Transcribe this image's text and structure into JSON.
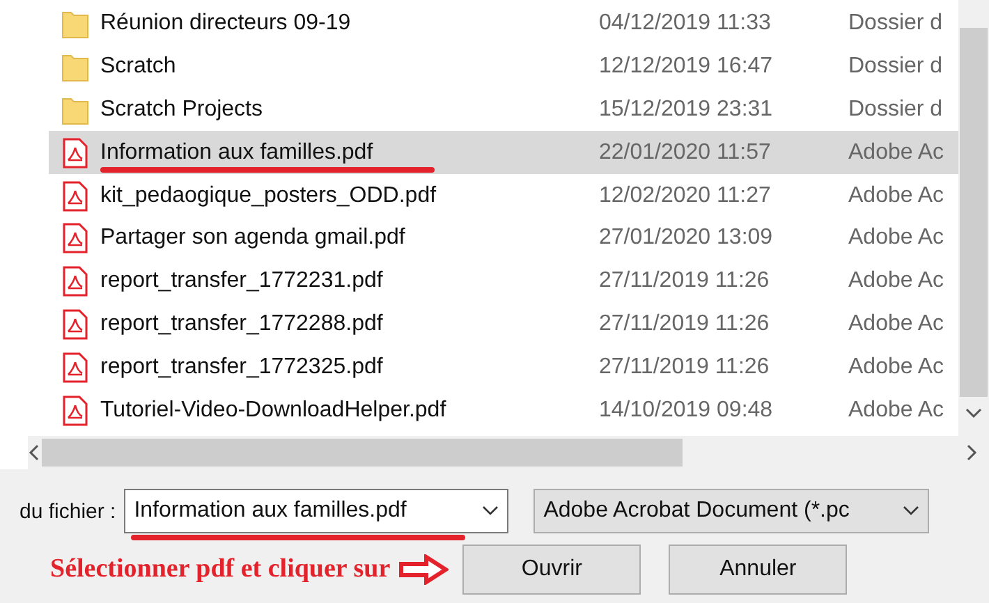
{
  "files": [
    {
      "kind": "folder",
      "name": "Réunion directeurs 09-19",
      "date": "04/12/2019 11:33",
      "type": "Dossier d",
      "selected": false,
      "underlined": false
    },
    {
      "kind": "folder",
      "name": "Scratch",
      "date": "12/12/2019 16:47",
      "type": "Dossier d",
      "selected": false,
      "underlined": false
    },
    {
      "kind": "folder",
      "name": "Scratch Projects",
      "date": "15/12/2019 23:31",
      "type": "Dossier d",
      "selected": false,
      "underlined": false
    },
    {
      "kind": "pdf",
      "name": "Information aux familles.pdf",
      "date": "22/01/2020 11:57",
      "type": "Adobe Ac",
      "selected": true,
      "underlined": true
    },
    {
      "kind": "pdf",
      "name": "kit_pedaogique_posters_ODD.pdf",
      "date": "12/02/2020 11:27",
      "type": "Adobe Ac",
      "selected": false,
      "underlined": false
    },
    {
      "kind": "pdf",
      "name": "Partager son agenda gmail.pdf",
      "date": "27/01/2020 13:09",
      "type": "Adobe Ac",
      "selected": false,
      "underlined": false
    },
    {
      "kind": "pdf",
      "name": "report_transfer_1772231.pdf",
      "date": "27/11/2019 11:26",
      "type": "Adobe Ac",
      "selected": false,
      "underlined": false
    },
    {
      "kind": "pdf",
      "name": "report_transfer_1772288.pdf",
      "date": "27/11/2019 11:26",
      "type": "Adobe Ac",
      "selected": false,
      "underlined": false
    },
    {
      "kind": "pdf",
      "name": "report_transfer_1772325.pdf",
      "date": "27/11/2019 11:26",
      "type": "Adobe Ac",
      "selected": false,
      "underlined": false
    },
    {
      "kind": "pdf",
      "name": "Tutoriel-Video-DownloadHelper.pdf",
      "date": "14/10/2019 09:48",
      "type": "Adobe Ac",
      "selected": false,
      "underlined": false
    }
  ],
  "filename": {
    "label": "du fichier :",
    "value": "Information aux familles.pdf",
    "underlined": true
  },
  "filetype": {
    "value": "Adobe Acrobat Document (*.pc"
  },
  "annotation": {
    "text": "Sélectionner pdf et cliquer sur"
  },
  "buttons": [
    "Ouvrir",
    "Annuler"
  ]
}
